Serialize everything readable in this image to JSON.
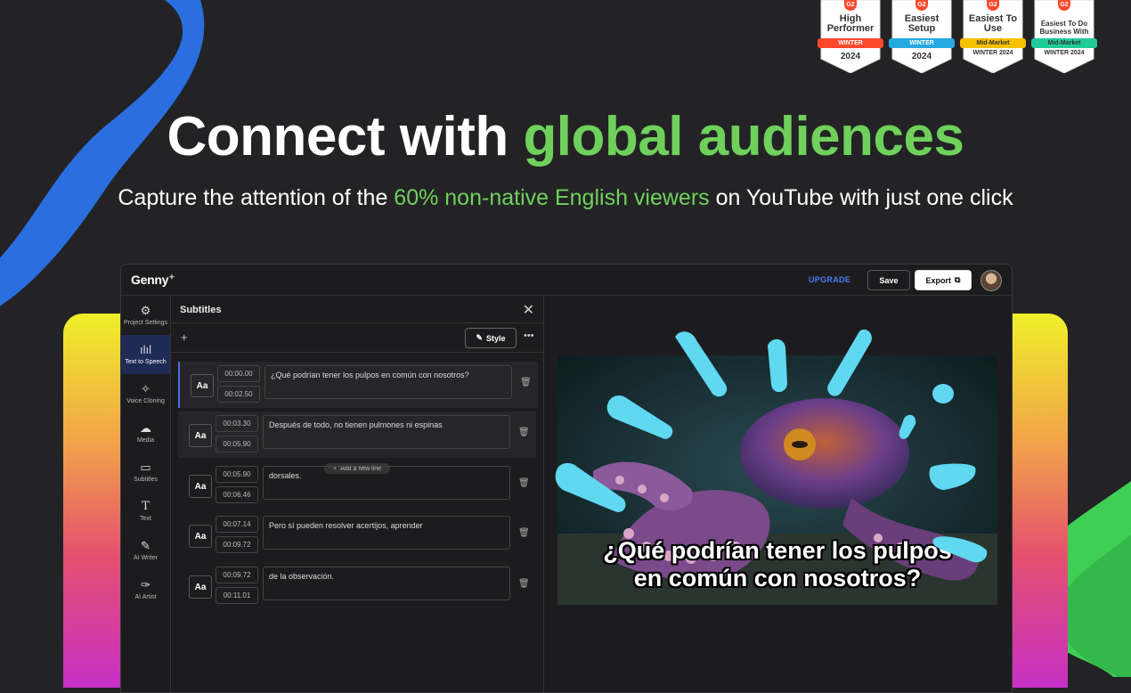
{
  "badges": [
    {
      "g2": "G2",
      "title": "High Performer",
      "ribbon": "WINTER",
      "ribbon_color": "#ff492c",
      "year": "2024"
    },
    {
      "g2": "G2",
      "title": "Easiest Setup",
      "ribbon": "WINTER",
      "ribbon_color": "#26a9e0",
      "year": "2024"
    },
    {
      "g2": "G2",
      "title": "Easiest To Use",
      "ribbon": "Mid-Market",
      "ribbon_color": "#f5c000",
      "year": "WINTER 2024"
    },
    {
      "g2": "G2",
      "title": "Easiest To Do Business With",
      "ribbon": "Mid-Market",
      "ribbon_color": "#1fcc9a",
      "year": "WINTER 2024"
    }
  ],
  "hero": {
    "title_plain": "Connect with ",
    "title_accent": "global audiences",
    "sub_before": "Capture the attention of the ",
    "sub_accent": "60% non-native English viewers",
    "sub_after": " on YouTube with just one click"
  },
  "colors": {
    "accent": "#6fd15c",
    "link_blue": "#4a7cf0",
    "active_nav": "#1f2a55"
  },
  "app": {
    "logo": "Genny",
    "upgrade_label": "UPGRADE",
    "save_label": "Save",
    "export_label": "Export",
    "sidebar": [
      {
        "icon": "gear-icon",
        "label": "Project Settings"
      },
      {
        "icon": "waveform-icon",
        "label": "Text to Speech",
        "active": true
      },
      {
        "icon": "voice-cloning-icon",
        "label": "Voice Cloning"
      },
      {
        "icon": "cloud-upload-icon",
        "label": "Media"
      },
      {
        "icon": "subtitles-icon",
        "label": "Subtitles"
      },
      {
        "icon": "text-icon",
        "label": "Text"
      },
      {
        "icon": "feather-icon",
        "label": "AI Writer"
      },
      {
        "icon": "brush-icon",
        "label": "AI Artist"
      }
    ],
    "panel": {
      "title": "Subtitles",
      "style_label": "Style",
      "add_line_label": "Add a new line",
      "style_label_aa": "Aa",
      "rows": [
        {
          "start": "00:00.00",
          "end": "00:02.50",
          "text": "¿Qué podrían tener los pulpos en común con nosotros?"
        },
        {
          "start": "00:03.30",
          "end": "00:05.90",
          "text": "Después de todo, no tienen pulmones ni espinas"
        },
        {
          "start": "00:05.90",
          "end": "00:06.46",
          "text": "dorsales."
        },
        {
          "start": "00:07.14",
          "end": "00:09.72",
          "text": "Pero sí pueden resolver acertijos, aprender"
        },
        {
          "start": "00:09.72",
          "end": "00:11.01",
          "text": "de la observación."
        }
      ]
    },
    "preview": {
      "caption_line1": "¿Qué podrían tener los pulpos",
      "caption_line2": "en común con nosotros?"
    }
  }
}
